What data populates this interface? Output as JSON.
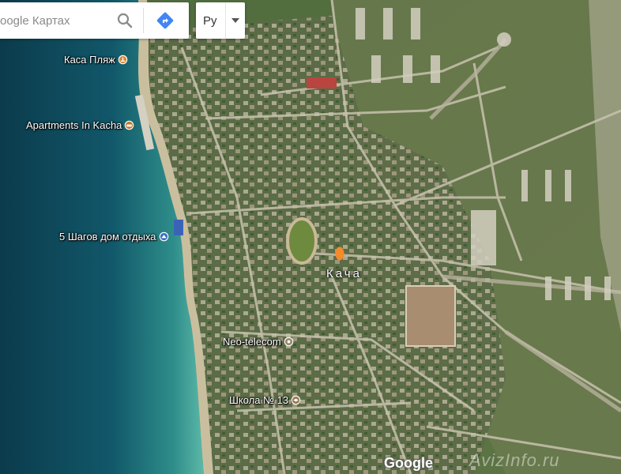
{
  "search": {
    "placeholder": "oogle Картах"
  },
  "language": {
    "selected": "Ру"
  },
  "town": {
    "name": "Кача"
  },
  "pois": [
    {
      "label": "Каса Пляж",
      "icon": "beach-icon"
    },
    {
      "label": "Apartments In Kacha",
      "icon": "hotel-icon"
    },
    {
      "label": "5 Шагов дом отдыха",
      "icon": "lodging-icon"
    },
    {
      "label": "Neo-telecom",
      "icon": "business-icon"
    },
    {
      "label": "Школа № 13",
      "icon": "school-icon"
    }
  ],
  "branding": {
    "logo": "Google",
    "watermark": "AvizInfo.ru"
  },
  "colors": {
    "sea_deep": "#0d4f63",
    "sea_shallow": "#4aa7a0",
    "land": "#4c6a3d",
    "accent_blue": "#4285f4",
    "pin_orange": "#f58a2a"
  }
}
